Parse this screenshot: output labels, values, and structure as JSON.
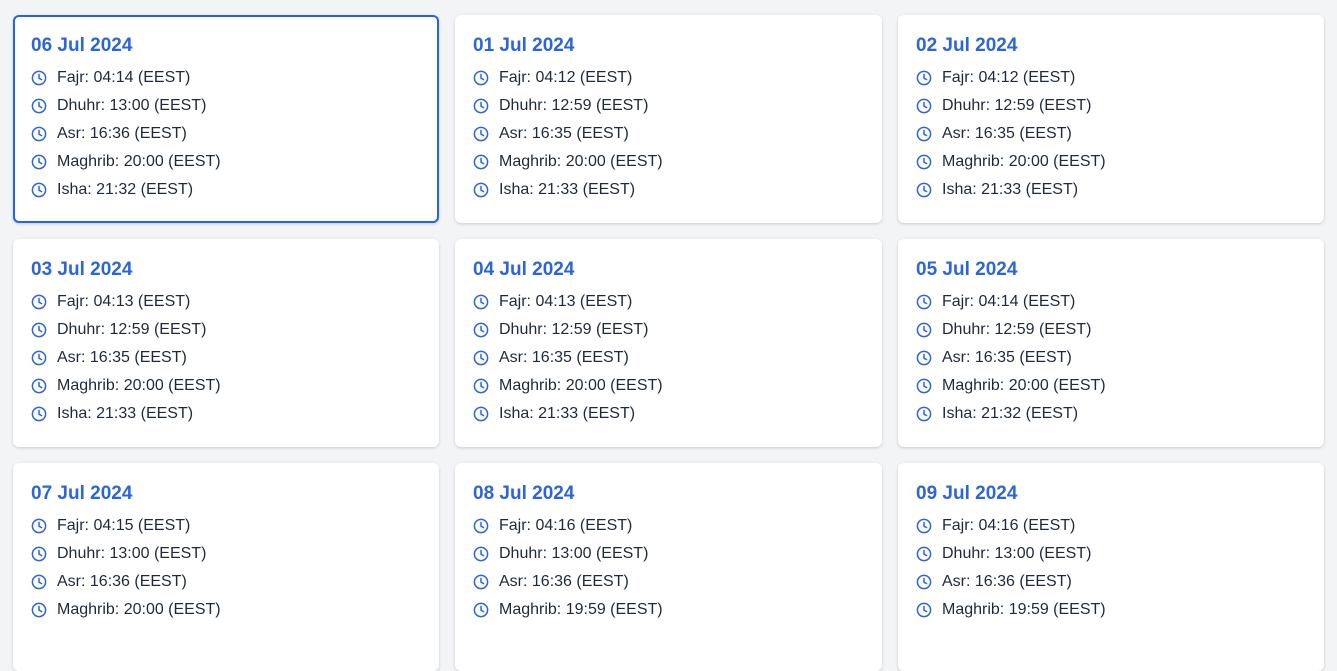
{
  "accent_color": "#2b65d9",
  "selected_border_color": "#2563eb",
  "cards": [
    {
      "date": "06 Jul 2024",
      "selected": true,
      "times": [
        "Fajr: 04:14 (EEST)",
        "Dhuhr: 13:00 (EEST)",
        "Asr: 16:36 (EEST)",
        "Maghrib: 20:00 (EEST)",
        "Isha: 21:32 (EEST)"
      ]
    },
    {
      "date": "01 Jul 2024",
      "selected": false,
      "times": [
        "Fajr: 04:12 (EEST)",
        "Dhuhr: 12:59 (EEST)",
        "Asr: 16:35 (EEST)",
        "Maghrib: 20:00 (EEST)",
        "Isha: 21:33 (EEST)"
      ]
    },
    {
      "date": "02 Jul 2024",
      "selected": false,
      "times": [
        "Fajr: 04:12 (EEST)",
        "Dhuhr: 12:59 (EEST)",
        "Asr: 16:35 (EEST)",
        "Maghrib: 20:00 (EEST)",
        "Isha: 21:33 (EEST)"
      ]
    },
    {
      "date": "03 Jul 2024",
      "selected": false,
      "times": [
        "Fajr: 04:13 (EEST)",
        "Dhuhr: 12:59 (EEST)",
        "Asr: 16:35 (EEST)",
        "Maghrib: 20:00 (EEST)",
        "Isha: 21:33 (EEST)"
      ]
    },
    {
      "date": "04 Jul 2024",
      "selected": false,
      "times": [
        "Fajr: 04:13 (EEST)",
        "Dhuhr: 12:59 (EEST)",
        "Asr: 16:35 (EEST)",
        "Maghrib: 20:00 (EEST)",
        "Isha: 21:33 (EEST)"
      ]
    },
    {
      "date": "05 Jul 2024",
      "selected": false,
      "times": [
        "Fajr: 04:14 (EEST)",
        "Dhuhr: 12:59 (EEST)",
        "Asr: 16:35 (EEST)",
        "Maghrib: 20:00 (EEST)",
        "Isha: 21:32 (EEST)"
      ]
    },
    {
      "date": "07 Jul 2024",
      "selected": false,
      "times": [
        "Fajr: 04:15 (EEST)",
        "Dhuhr: 13:00 (EEST)",
        "Asr: 16:36 (EEST)",
        "Maghrib: 20:00 (EEST)"
      ]
    },
    {
      "date": "08 Jul 2024",
      "selected": false,
      "times": [
        "Fajr: 04:16 (EEST)",
        "Dhuhr: 13:00 (EEST)",
        "Asr: 16:36 (EEST)",
        "Maghrib: 19:59 (EEST)"
      ]
    },
    {
      "date": "09 Jul 2024",
      "selected": false,
      "times": [
        "Fajr: 04:16 (EEST)",
        "Dhuhr: 13:00 (EEST)",
        "Asr: 16:36 (EEST)",
        "Maghrib: 19:59 (EEST)"
      ]
    }
  ],
  "icon": "clock-icon"
}
